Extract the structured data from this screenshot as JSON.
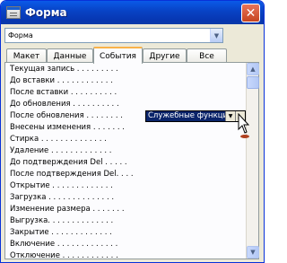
{
  "window": {
    "title": "Форма",
    "close_glyph": "✕"
  },
  "object_selector": {
    "value": "Форма"
  },
  "tabs": [
    {
      "label": "Макет",
      "active": false
    },
    {
      "label": "Данные",
      "active": false
    },
    {
      "label": "События",
      "active": true
    },
    {
      "label": "Другие",
      "active": false
    },
    {
      "label": "Все",
      "active": false
    }
  ],
  "events": [
    {
      "label": "Текущая запись . . . . . . . . ."
    },
    {
      "label": "До вставки . . . . . . . . . . . ."
    },
    {
      "label": "После вставки . . . . . . . . . ."
    },
    {
      "label": "До обновления . . . . . . . . . ."
    },
    {
      "label": "После обновления . . . . . . . ."
    },
    {
      "label": "Внесены изменения . . . . . . ."
    },
    {
      "label": "Стирка . . . . . . . . . . . . . ."
    },
    {
      "label": "Удаление . . . . . . . . . . . . ."
    },
    {
      "label": "До подтверждения Del . . . . ."
    },
    {
      "label": "После подтверждения Del. . . ."
    },
    {
      "label": "Открытие . . . . . . . . . . . . ."
    },
    {
      "label": "Загрузка . . . . . . . . . . . . . ."
    },
    {
      "label": "Изменение размера . . . . . . ."
    },
    {
      "label": "Выгрузка. . . . . . . . . . . . . ."
    },
    {
      "label": "Закрытие . . . . . . . . . . . . ."
    },
    {
      "label": "Включение . . . . . . . . . . . . ."
    },
    {
      "label": "Отключение . . . . . . . . . . . ."
    }
  ],
  "selected_event": {
    "value": "Служебные функции",
    "builder_glyph": "..."
  },
  "icons": {
    "dropdown": "chevron-down-icon",
    "scroll_up": "arrow-up-icon",
    "scroll_down": "arrow-down-icon",
    "cursor": "mouse-pointer-icon"
  }
}
